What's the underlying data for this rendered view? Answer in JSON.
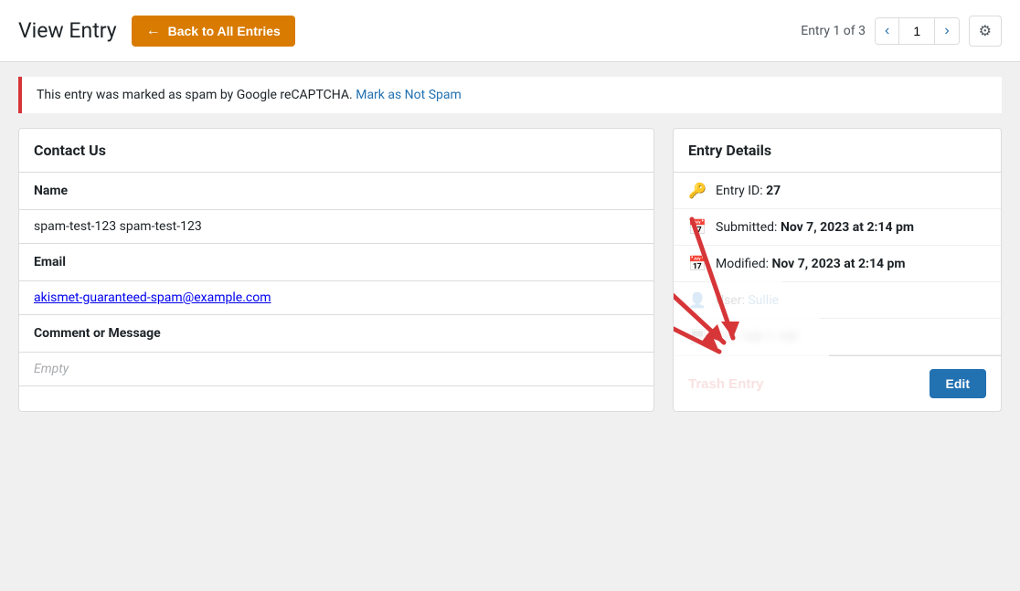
{
  "header": {
    "page_title": "View Entry",
    "back_button_label": "Back to All Entries",
    "entry_counter": "Entry 1 of 3",
    "nav_current_page": "1",
    "settings_icon": "⚙"
  },
  "spam_notice": {
    "text": "This entry was marked as spam by Google reCAPTCHA.",
    "link_text": "Mark as Not Spam"
  },
  "contact_form": {
    "title": "Contact Us",
    "fields": [
      {
        "label": "Name",
        "value": "spam-test-123 spam-test-123",
        "type": "text"
      },
      {
        "label": "Email",
        "value": "akismet-guaranteed-spam@example.com",
        "type": "email"
      },
      {
        "label": "Comment or Message",
        "value": "Empty",
        "type": "empty"
      }
    ]
  },
  "entry_details": {
    "title": "Entry Details",
    "entry_id_label": "Entry ID:",
    "entry_id_value": "27",
    "submitted_label": "Submitted:",
    "submitted_value": "Nov 7, 2023 at 2:14 pm",
    "modified_label": "Modified:",
    "modified_value": "Nov 7, 2023 at 2:14 pm",
    "user_label": "User:",
    "user_value": "Sullie",
    "ip_label": "IP:",
    "ip_value": "███ ███ ███ ███",
    "trash_button_label": "Trash Entry",
    "edit_button_label": "Edit"
  },
  "icons": {
    "back_arrow": "←",
    "key": "🔑",
    "calendar": "📅",
    "user": "👤",
    "ip": "🖥",
    "prev": "‹",
    "next": "›"
  }
}
